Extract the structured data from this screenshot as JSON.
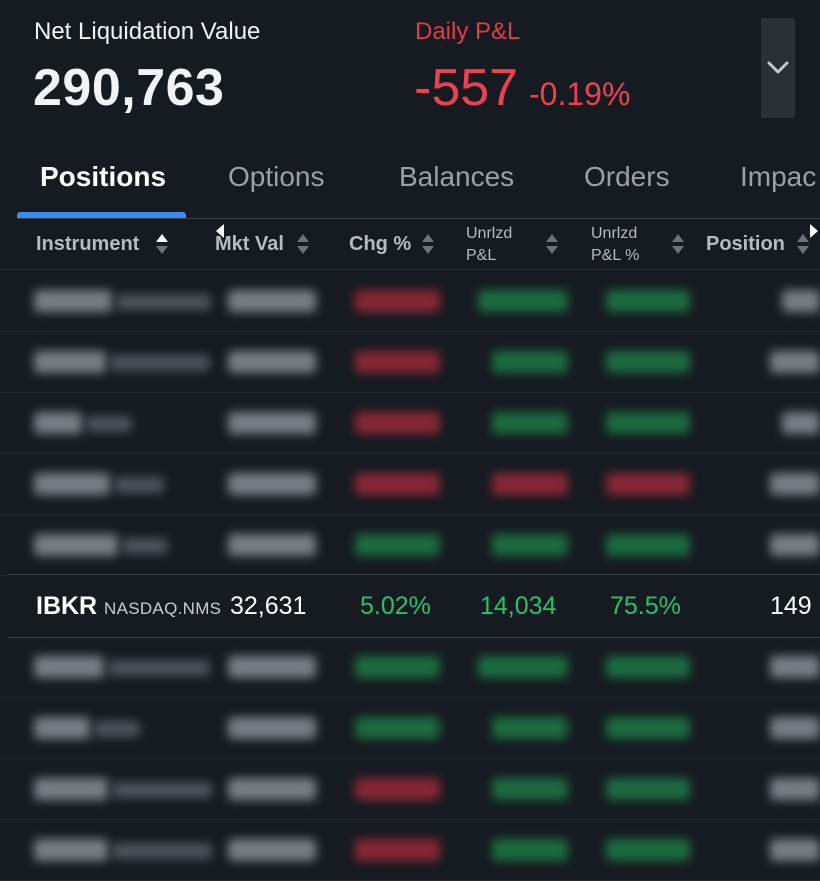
{
  "summary": {
    "nlv_label": "Net Liquidation Value",
    "nlv_value": "290,763",
    "pnl_label": "Daily P&L",
    "pnl_value": "-557",
    "pnl_pct": "-0.19%"
  },
  "tabs": [
    "Positions",
    "Options",
    "Balances",
    "Orders",
    "Impac"
  ],
  "active_tab": "Positions",
  "columns": {
    "instrument": "Instrument",
    "mkt_val": "Mkt Val",
    "chg_pct": "Chg %",
    "unrlzd_pnl_line1": "Unrlzd",
    "unrlzd_pnl_line2": "P&L",
    "unrlzd_pnl_pct_line1": "Unrlzd",
    "unrlzd_pnl_pct_line2": "P&L %",
    "position": "Position"
  },
  "visible_row": {
    "symbol": "IBKR",
    "exchange": "NASDAQ.NMS",
    "mkt_val": "32,631",
    "chg_pct": "5.02%",
    "unrlzd_pnl": "14,034",
    "unrlzd_pnl_pct": "75.5%",
    "position": "149"
  },
  "colors": {
    "background": "#161a21",
    "negative": "#ef4052",
    "positive": "#27c26b",
    "accent": "#3f8cf0"
  },
  "icons": {
    "expand": "chevron-down-icon",
    "sort": "sort-updown-icon",
    "scroll_left": "caret-left-icon",
    "scroll_right": "caret-right-icon"
  }
}
